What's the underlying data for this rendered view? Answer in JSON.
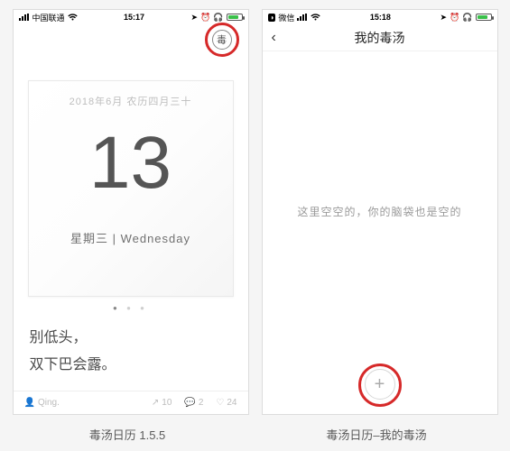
{
  "screen1": {
    "status": {
      "carrier": "中国联通",
      "time": "15:17"
    },
    "du_button": "毒",
    "date_line": "2018年6月   农历四月三十",
    "big_number": "13",
    "weekday": "星期三   |   Wednesday",
    "quote_line1": "别低头，",
    "quote_line2": "双下巴会露。",
    "footer": {
      "author": "Qing.",
      "share_count": "10",
      "comment_count": "2",
      "like_count": "24"
    },
    "caption": "毒汤日历 1.5.5"
  },
  "screen2": {
    "status": {
      "carrier": "微信",
      "time": "15:18"
    },
    "nav_title": "我的毒汤",
    "empty_text": "这里空空的，你的脑袋也是空的",
    "add_label": "+",
    "caption": "毒汤日历–我的毒汤"
  }
}
